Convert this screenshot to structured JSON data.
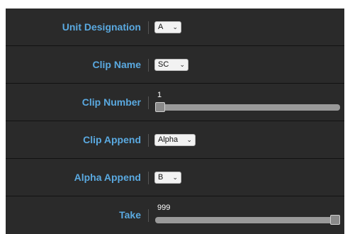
{
  "rows": [
    {
      "label": "Unit Designation",
      "type": "select",
      "value": "A"
    },
    {
      "label": "Clip Name",
      "type": "select",
      "value": "SC"
    },
    {
      "label": "Clip Number",
      "type": "slider",
      "value": "1",
      "fraction": 0
    },
    {
      "label": "Clip Append",
      "type": "select",
      "value": "Alpha"
    },
    {
      "label": "Alpha Append",
      "type": "select",
      "value": "B"
    },
    {
      "label": "Take",
      "type": "slider",
      "value": "999",
      "fraction": 1
    }
  ],
  "icons": {
    "dropdown": "chevron-down-icon"
  },
  "colors": {
    "label": "#5aa9e0",
    "panel": "#2a2a2a"
  }
}
